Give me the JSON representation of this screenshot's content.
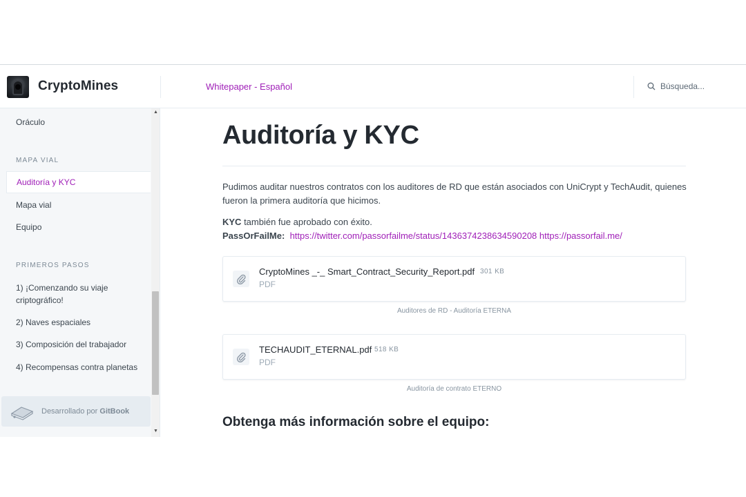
{
  "header": {
    "site_title": "CryptoMines",
    "space_link": "Whitepaper - Español",
    "search_placeholder": "Búsqueda..."
  },
  "sidebar": {
    "items": [
      {
        "label": "Oráculo"
      },
      {
        "section": "MAPA VIAL"
      },
      {
        "label": "Auditoría y KYC",
        "active": true
      },
      {
        "label": "Mapa vial"
      },
      {
        "label": "Equipo"
      },
      {
        "section": "PRIMEROS PASOS"
      },
      {
        "label": "1) ¡Comenzando su viaje criptográfico!"
      },
      {
        "label": "2) Naves espaciales"
      },
      {
        "label": "3) Composición del trabajador"
      },
      {
        "label": "4) Recompensas contra planetas"
      }
    ],
    "footer": {
      "prefix": "Desarrollado por",
      "brand": "GitBook"
    }
  },
  "main": {
    "title": "Auditoría y KYC",
    "intro": "Pudimos auditar nuestros contratos con los auditores de RD que están asociados con UniCrypt y TechAudit, quienes fueron la primera auditoría que hicimos.",
    "kyc_bold": "KYC",
    "kyc_text": " también fue aprobado con éxito.",
    "passorfail_label": "PassOrFailMe:",
    "link_twitter": "https://twitter.com/passorfailme/status/1436374238634590208",
    "link_site": "https://passorfail.me/",
    "files": [
      {
        "name": "CryptoMines _-_ Smart_Contract_Security_Report.pdf",
        "size": "301 KB",
        "type": "PDF",
        "caption": "Auditores de RD - Auditoría ETERNA"
      },
      {
        "name": "TECHAUDIT_ETERNAL.pdf",
        "size": "518 KB",
        "type": "PDF",
        "caption": "Auditoría de contrato ETERNO"
      }
    ],
    "section_heading": "Obtenga más información sobre el equipo:"
  },
  "colors": {
    "accent": "#a020b8",
    "sidebar_bg": "#f5f7f9",
    "text": "#3b454e"
  }
}
